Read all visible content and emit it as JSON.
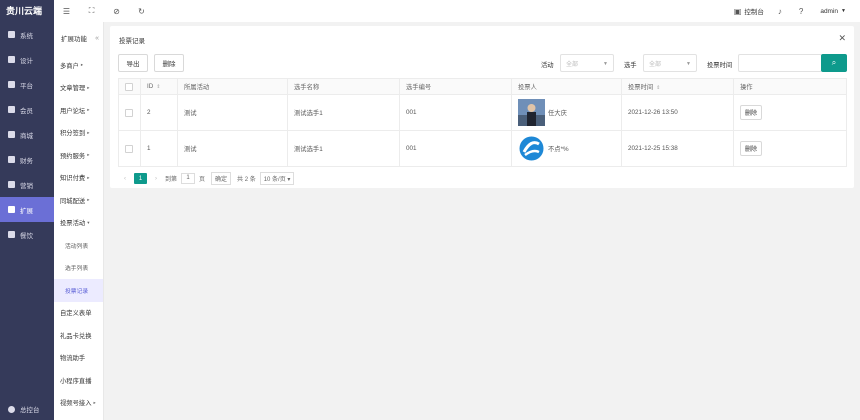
{
  "brand": "贵川云端",
  "sidebar": {
    "items": [
      {
        "label": "系统"
      },
      {
        "label": "设计"
      },
      {
        "label": "平台"
      },
      {
        "label": "会员"
      },
      {
        "label": "商城"
      },
      {
        "label": "财务"
      },
      {
        "label": "营销"
      },
      {
        "label": "扩展"
      },
      {
        "label": "餐饮"
      }
    ],
    "active_index": 7,
    "bottom_label": "总控台"
  },
  "subbar": {
    "title": "扩展功能",
    "collapse_glyph": "«",
    "items": [
      {
        "label": "多商户",
        "arrow": "▸"
      },
      {
        "label": "文章管理",
        "arrow": "▸"
      },
      {
        "label": "用户论坛",
        "arrow": "▸"
      },
      {
        "label": "积分签到",
        "arrow": "▸"
      },
      {
        "label": "预约服务",
        "arrow": "▸"
      },
      {
        "label": "知识付费",
        "arrow": "▸"
      },
      {
        "label": "同城配送",
        "arrow": "▸"
      },
      {
        "label": "投票活动",
        "arrow": "▾"
      }
    ],
    "children": [
      {
        "label": "活动列表"
      },
      {
        "label": "选手列表"
      },
      {
        "label": "投票记录"
      }
    ],
    "after": [
      {
        "label": "自定义表单",
        "arrow": ""
      },
      {
        "label": "礼品卡兑换",
        "arrow": ""
      },
      {
        "label": "物流助手",
        "arrow": ""
      },
      {
        "label": "小程序直播",
        "arrow": ""
      },
      {
        "label": "视频号接入",
        "arrow": "▸"
      }
    ]
  },
  "header": {
    "console": "控制台",
    "user": "admin"
  },
  "panel": {
    "title": "投票记录",
    "export_label": "导出",
    "delete_label": "删除",
    "filters": {
      "activity_label": "活动",
      "activity_value": "全部",
      "player_label": "选手",
      "player_value": "全部",
      "time_label": "投票时间"
    },
    "columns": [
      "ID",
      "所属活动",
      "选手名称",
      "选手编号",
      "投票人",
      "投票时间",
      "操作"
    ],
    "rows": [
      {
        "id": "2",
        "activity": "测试",
        "player": "测试选手1",
        "number": "001",
        "voter": "任大庆",
        "time": "2021-12-26 13:50",
        "action": "删除"
      },
      {
        "id": "1",
        "activity": "测试",
        "player": "测试选手1",
        "number": "001",
        "voter": "不点*%",
        "time": "2021-12-25 15:38",
        "action": "删除"
      }
    ],
    "pager": {
      "current": "1",
      "goto_label": "到第",
      "goto_value": "1",
      "page_unit": "页",
      "confirm": "确定",
      "total": "共 2 条",
      "page_size": "10 条/页"
    }
  }
}
